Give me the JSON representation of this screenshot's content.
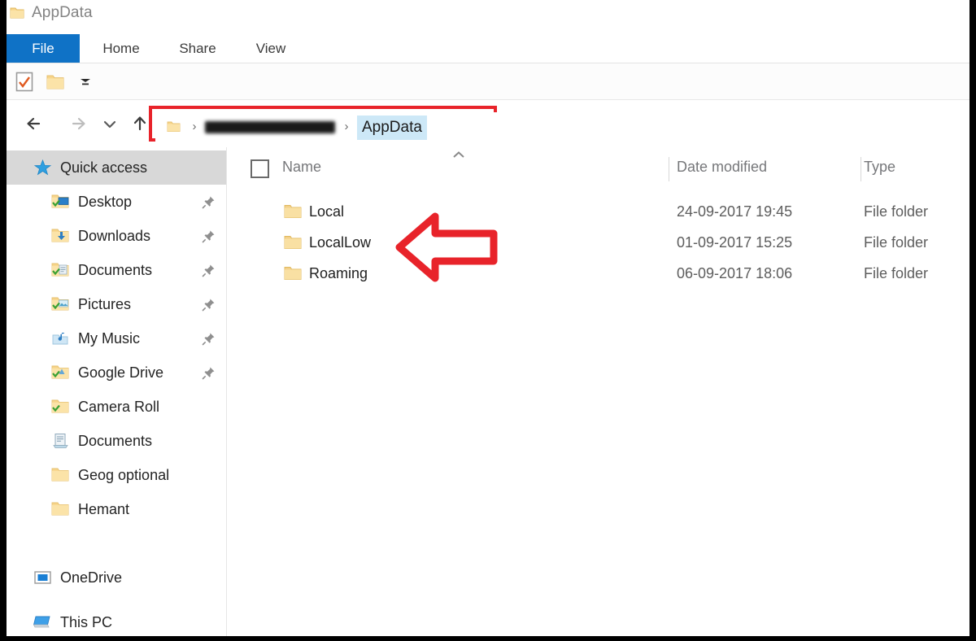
{
  "window": {
    "title": "AppData",
    "title_icon": "folder-icon",
    "accent_color": "#0f72c6",
    "annotation_color": "#e8232a"
  },
  "ribbon": {
    "tabs": [
      {
        "label": "File",
        "selected": true
      },
      {
        "label": "Home",
        "selected": false
      },
      {
        "label": "Share",
        "selected": false
      },
      {
        "label": "View",
        "selected": false
      }
    ]
  },
  "quick_access_toolbar": {
    "items": [
      {
        "icon": "properties-icon"
      },
      {
        "icon": "new-folder-icon"
      },
      {
        "icon": "chevron-down-icon"
      }
    ]
  },
  "navigation": {
    "back": "back-arrow-icon",
    "forward": "forward-arrow-icon",
    "recent": "chevron-down-icon",
    "up": "up-arrow-icon",
    "forward_disabled": true
  },
  "address_bar": {
    "highlighted": true,
    "leading_icon": "folder-icon",
    "separator": "›",
    "crumbs": [
      {
        "label": "",
        "redacted": true
      },
      {
        "label": "AppData",
        "current": true
      }
    ]
  },
  "sidebar": {
    "items": [
      {
        "label": "Quick access",
        "icon": "star-icon",
        "level": 0,
        "selected": true,
        "pinned": false
      },
      {
        "label": "Desktop",
        "icon": "desktop-folder-icon",
        "level": 1,
        "selected": false,
        "pinned": true
      },
      {
        "label": "Downloads",
        "icon": "downloads-folder-icon",
        "level": 1,
        "selected": false,
        "pinned": true
      },
      {
        "label": "Documents",
        "icon": "documents-folder-icon",
        "level": 1,
        "selected": false,
        "pinned": true
      },
      {
        "label": "Pictures",
        "icon": "pictures-folder-icon",
        "level": 1,
        "selected": false,
        "pinned": true
      },
      {
        "label": "My Music",
        "icon": "music-folder-icon",
        "level": 1,
        "selected": false,
        "pinned": true
      },
      {
        "label": "Google Drive",
        "icon": "sync-folder-icon",
        "level": 1,
        "selected": false,
        "pinned": true
      },
      {
        "label": "Camera Roll",
        "icon": "sync-folder-icon",
        "level": 1,
        "selected": false,
        "pinned": false
      },
      {
        "label": "Documents",
        "icon": "library-icon",
        "level": 1,
        "selected": false,
        "pinned": false
      },
      {
        "label": "Geog optional",
        "icon": "folder-icon",
        "level": 1,
        "selected": false,
        "pinned": false
      },
      {
        "label": "Hemant",
        "icon": "folder-icon",
        "level": 1,
        "selected": false,
        "pinned": false
      },
      {
        "label": "OneDrive",
        "icon": "onedrive-icon",
        "level": 0,
        "selected": false,
        "pinned": false
      },
      {
        "label": "This PC",
        "icon": "this-pc-icon",
        "level": 0,
        "selected": false,
        "pinned": false
      }
    ]
  },
  "file_list": {
    "sort_indicator": "chevron-up-icon",
    "select_all_checked": false,
    "columns": [
      "Name",
      "Date modified",
      "Type"
    ],
    "rows": [
      {
        "name": "Local",
        "date": "24-09-2017 19:45",
        "type": "File folder",
        "icon": "folder-icon"
      },
      {
        "name": "LocalLow",
        "date": "01-09-2017 15:25",
        "type": "File folder",
        "icon": "folder-icon"
      },
      {
        "name": "Roaming",
        "date": "06-09-2017 18:06",
        "type": "File folder",
        "icon": "folder-icon"
      }
    ]
  },
  "annotations": {
    "arrow": {
      "direction": "left",
      "target": "LocalLow",
      "color": "#e8232a"
    },
    "rectangle": {
      "target": "address-bar",
      "color": "#e8232a"
    }
  }
}
